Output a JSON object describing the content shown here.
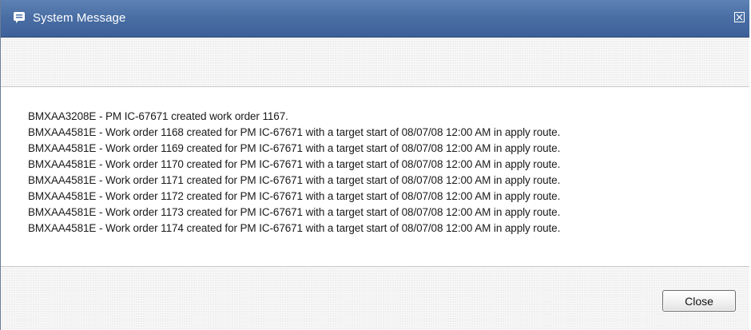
{
  "window": {
    "title": "System Message",
    "icon": "message-icon",
    "close_icon": "close-icon"
  },
  "messages": [
    "BMXAA3208E - PM IC-67671 created work order 1167.",
    "BMXAA4581E - Work order 1168 created for PM IC-67671 with a target start of 08/07/08 12:00 AM in apply route.",
    "BMXAA4581E - Work order 1169 created for PM IC-67671 with a target start of 08/07/08 12:00 AM in apply route.",
    "BMXAA4581E - Work order 1170 created for PM IC-67671 with a target start of 08/07/08 12:00 AM in apply route.",
    "BMXAA4581E - Work order 1171 created for PM IC-67671 with a target start of 08/07/08 12:00 AM in apply route.",
    "BMXAA4581E - Work order 1172 created for PM IC-67671 with a target start of 08/07/08 12:00 AM in apply route.",
    "BMXAA4581E - Work order 1173 created for PM IC-67671 with a target start of 08/07/08 12:00 AM in apply route.",
    "BMXAA4581E - Work order 1174 created for PM IC-67671 with a target start of 08/07/08 12:00 AM in apply route."
  ],
  "footer": {
    "close_label": "Close"
  },
  "colors": {
    "titlebar": "#4a6fa5",
    "title_text": "#ffffff",
    "band_background": "#efefef",
    "message_text": "#1a1a1a"
  }
}
